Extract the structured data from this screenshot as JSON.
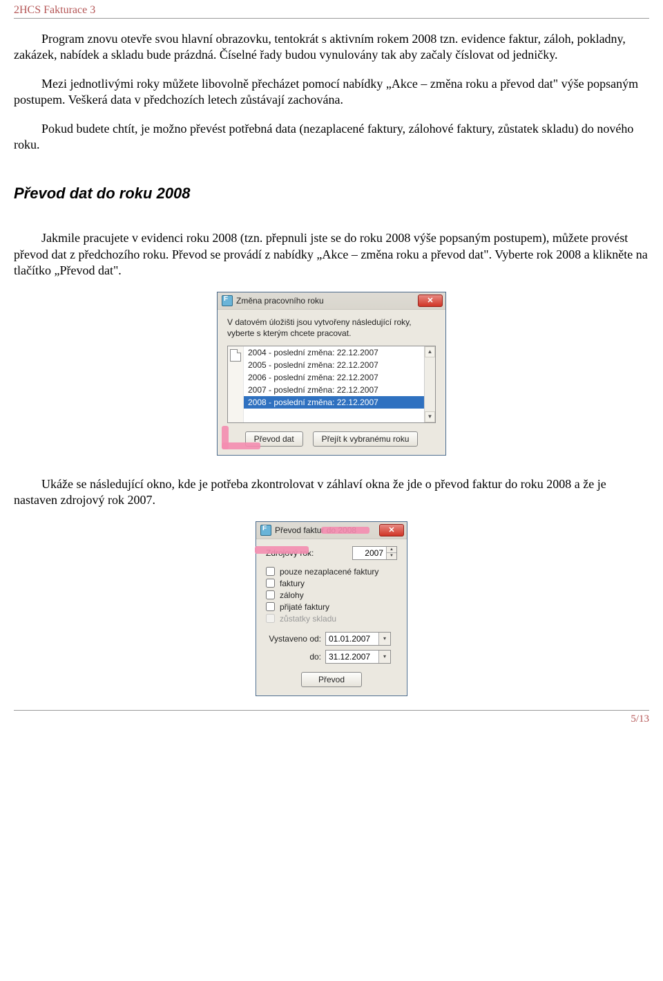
{
  "header": {
    "title": "2HCS Fakturace 3"
  },
  "body": {
    "p1": "Program znovu otevře svou hlavní obrazovku, tentokrát s aktivním rokem 2008 tzn. evidence faktur, záloh, pokladny, zakázek, nabídek a skladu bude prázdná. Číselné řady budou vynulovány tak aby začaly číslovat od jedničky.",
    "p2": "Mezi jednotlivými roky můžete libovolně přecházet pomocí nabídky „Akce – změna roku a převod dat\" výše popsaným postupem. Veškerá data v předchozích letech zůstávají zachována.",
    "p3": "Pokud budete chtít, je možno převést potřebná data (nezaplacené faktury, zálohové faktury, zůstatek skladu) do nového roku.",
    "section_title": "Převod dat do roku 2008",
    "p4": "Jakmile pracujete v evidenci roku 2008 (tzn. přepnuli jste se do roku 2008 výše popsaným postupem), můžete provést převod dat z předchozího roku. Převod se provádí z nabídky „Akce – změna roku a převod dat\". Vyberte rok 2008 a klikněte na tlačítko „Převod dat\".",
    "p5": "Ukáže se následující okno, kde je potřeba zkontrolovat v záhlaví okna že jde o převod faktur do roku 2008 a že je nastaven zdrojový rok 2007."
  },
  "dialog1": {
    "title": "Změna pracovního roku",
    "info": "V datovém úložišti jsou vytvořeny následující roky, vyberte s kterým chcete pracovat.",
    "items": [
      {
        "text": "2004 - poslední změna: 22.12.2007",
        "selected": false
      },
      {
        "text": "2005 - poslední změna: 22.12.2007",
        "selected": false
      },
      {
        "text": "2006 - poslední změna: 22.12.2007",
        "selected": false
      },
      {
        "text": "2007 - poslední změna: 22.12.2007",
        "selected": false
      },
      {
        "text": "2008 - poslední změna: 22.12.2007",
        "selected": true
      }
    ],
    "btn_prevod": "Převod dat",
    "btn_goto": "Přejít k vybranému roku"
  },
  "dialog2": {
    "title": "Převod faktur do 2008",
    "zdroj_label": "Zdrojový rok:",
    "zdroj_value": "2007",
    "chk1": "pouze nezaplacené faktury",
    "chk2": "faktury",
    "chk3": "zálohy",
    "chk4": "přijaté faktury",
    "chk5": "zůstatky skladu",
    "vystaveno_label": "Vystaveno od:",
    "vystaveno_value": "01.01.2007",
    "do_label": "do:",
    "do_value": "31.12.2007",
    "btn_prevod": "Převod"
  },
  "footer": {
    "page": "5/13"
  }
}
